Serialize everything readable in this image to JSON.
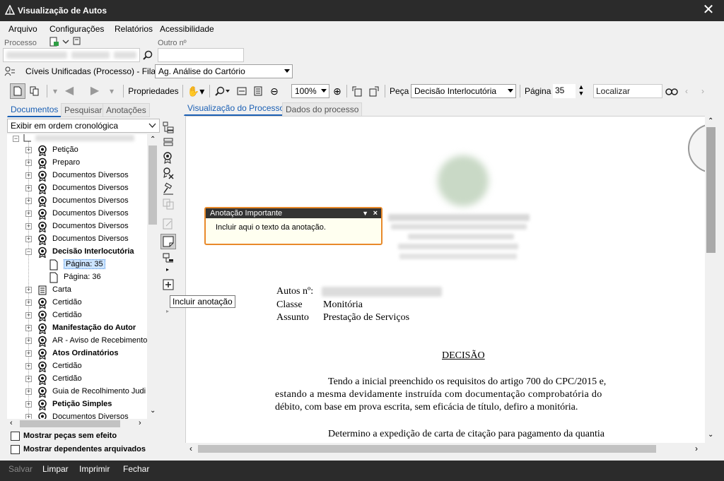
{
  "window": {
    "title": "Visualização de Autos",
    "close_label": "✕"
  },
  "menu": [
    "Arquivo",
    "Configurações",
    "Relatórios",
    "Acessibilidade"
  ],
  "search": {
    "processo_label": "Processo",
    "outro_label": "Outro nº"
  },
  "fila": {
    "text": "Cíveis Unificadas (Processo) - Fila:",
    "selected": "Ag. Análise do Cartório"
  },
  "toolbar": {
    "propriedades_label": "Propriedades",
    "zoom": "100%",
    "peca_label": "Peça",
    "peca_selected": "Decisão Interlocutória",
    "pagina_label": "Página",
    "pagina_value": "35",
    "localizar_placeholder": "Localizar"
  },
  "left_tabs": [
    "Documentos",
    "Pesquisar",
    "Anotações"
  ],
  "order_select": "Exibir em ordem cronológica",
  "tree": [
    {
      "label": "Petição",
      "bold": false
    },
    {
      "label": "Preparo",
      "bold": false
    },
    {
      "label": "Documentos Diversos",
      "bold": false
    },
    {
      "label": "Documentos Diversos",
      "bold": false
    },
    {
      "label": "Documentos Diversos",
      "bold": false
    },
    {
      "label": "Documentos Diversos",
      "bold": false
    },
    {
      "label": "Documentos Diversos",
      "bold": false
    },
    {
      "label": "Documentos Diversos",
      "bold": false
    },
    {
      "label": "Decisão Interlocutória",
      "bold": true,
      "expanded": true
    },
    {
      "label": "Página: 35",
      "page": true,
      "selected": true
    },
    {
      "label": "Página: 36",
      "page": true
    },
    {
      "label": "Carta",
      "bold": false
    },
    {
      "label": "Certidão",
      "bold": false
    },
    {
      "label": "Certidão",
      "bold": false
    },
    {
      "label": "Manifestação do Autor",
      "bold": true
    },
    {
      "label": "AR - Aviso de Recebimento",
      "bold": false
    },
    {
      "label": "Atos Ordinatórios",
      "bold": true
    },
    {
      "label": "Certidão",
      "bold": false
    },
    {
      "label": "Certidão",
      "bold": false
    },
    {
      "label": "Guia de Recolhimento Judi",
      "bold": false
    },
    {
      "label": "Petição Simples",
      "bold": true
    },
    {
      "label": "Documentos Diversos",
      "bold": false
    }
  ],
  "checkboxes": [
    "Mostrar peças sem efeito",
    "Mostrar dependentes arquivados"
  ],
  "view_tabs": [
    "Visualização do Processo",
    "Dados do processo"
  ],
  "annotation": {
    "title": "Anotação Importante",
    "text": "Incluir aqui o texto da anotação."
  },
  "tooltip": "Incluir anotação",
  "document": {
    "autos_label": "Autos nº:",
    "classe_label": "Classe",
    "classe_value": "Monitória",
    "assunto_label": "Assunto",
    "assunto_value": "Prestação de Serviços",
    "heading": "DECISÃO",
    "para1_l1": "Tendo a inicial preenchido os requisitos do artigo 700 do CPC/2015 e,",
    "para1_l2": "estando a mesma devidamente instruída com documentação comprobatória do",
    "para1_l3": "débito, com base em prova escrita, sem eficácia de título, defiro a monitória.",
    "para2_l1": "Determino a expedição de carta de citação para pagamento da quantia"
  },
  "bottom": [
    "Salvar",
    "Limpar",
    "Imprimir",
    "Fechar"
  ]
}
